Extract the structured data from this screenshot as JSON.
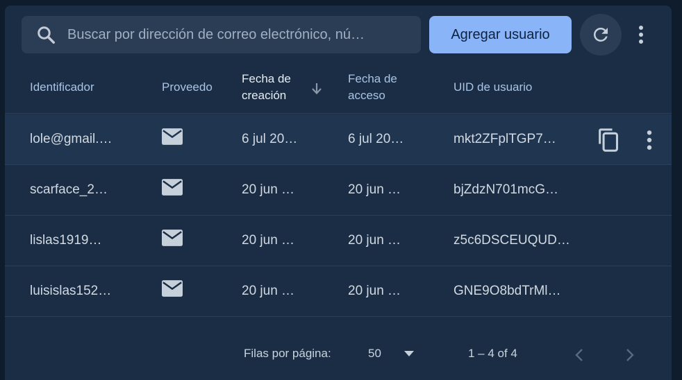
{
  "toolbar": {
    "search_placeholder": "Buscar por dirección de correo electrónico, nú…",
    "add_user_label": "Agregar usuario",
    "refresh_icon": "refresh-icon",
    "more_icon": "more-vert-icon"
  },
  "table": {
    "columns": [
      {
        "label": "Identificador"
      },
      {
        "label": "Proveedo"
      },
      {
        "label": "Fecha de creación",
        "line1": "Fecha de",
        "line2": "creación",
        "sorted": "desc"
      },
      {
        "label": "Fecha de acceso",
        "line1": "Fecha de",
        "line2": "acceso"
      },
      {
        "label": "UID de usuario"
      }
    ],
    "rows": [
      {
        "identifier": "lole@gmail.…",
        "provider": "mail-icon",
        "created": "6 jul 20…",
        "accessed": "6 jul 20…",
        "uid": "mkt2ZFplTGP7…"
      },
      {
        "identifier": "scarface_2…",
        "provider": "mail-icon",
        "created": "20 jun …",
        "accessed": "20 jun …",
        "uid": "bjZdzN701mcG…"
      },
      {
        "identifier": "lislas1919…",
        "provider": "mail-icon",
        "created": "20 jun …",
        "accessed": "20 jun …",
        "uid": "z5c6DSCEUQUD…"
      },
      {
        "identifier": "luisislas152…",
        "provider": "mail-icon",
        "created": "20 jun …",
        "accessed": "20 jun …",
        "uid": "GNE9O8bdTrMl…"
      }
    ]
  },
  "footer": {
    "rows_per_page_label": "Filas por página:",
    "rows_per_page_value": "50",
    "range_label": "1 – 4 of 4"
  },
  "colors": {
    "background": "#0f1c2c",
    "panel": "#1a2d45",
    "accent_button": "#8ab4f8",
    "header_text": "#a9c4e4"
  }
}
